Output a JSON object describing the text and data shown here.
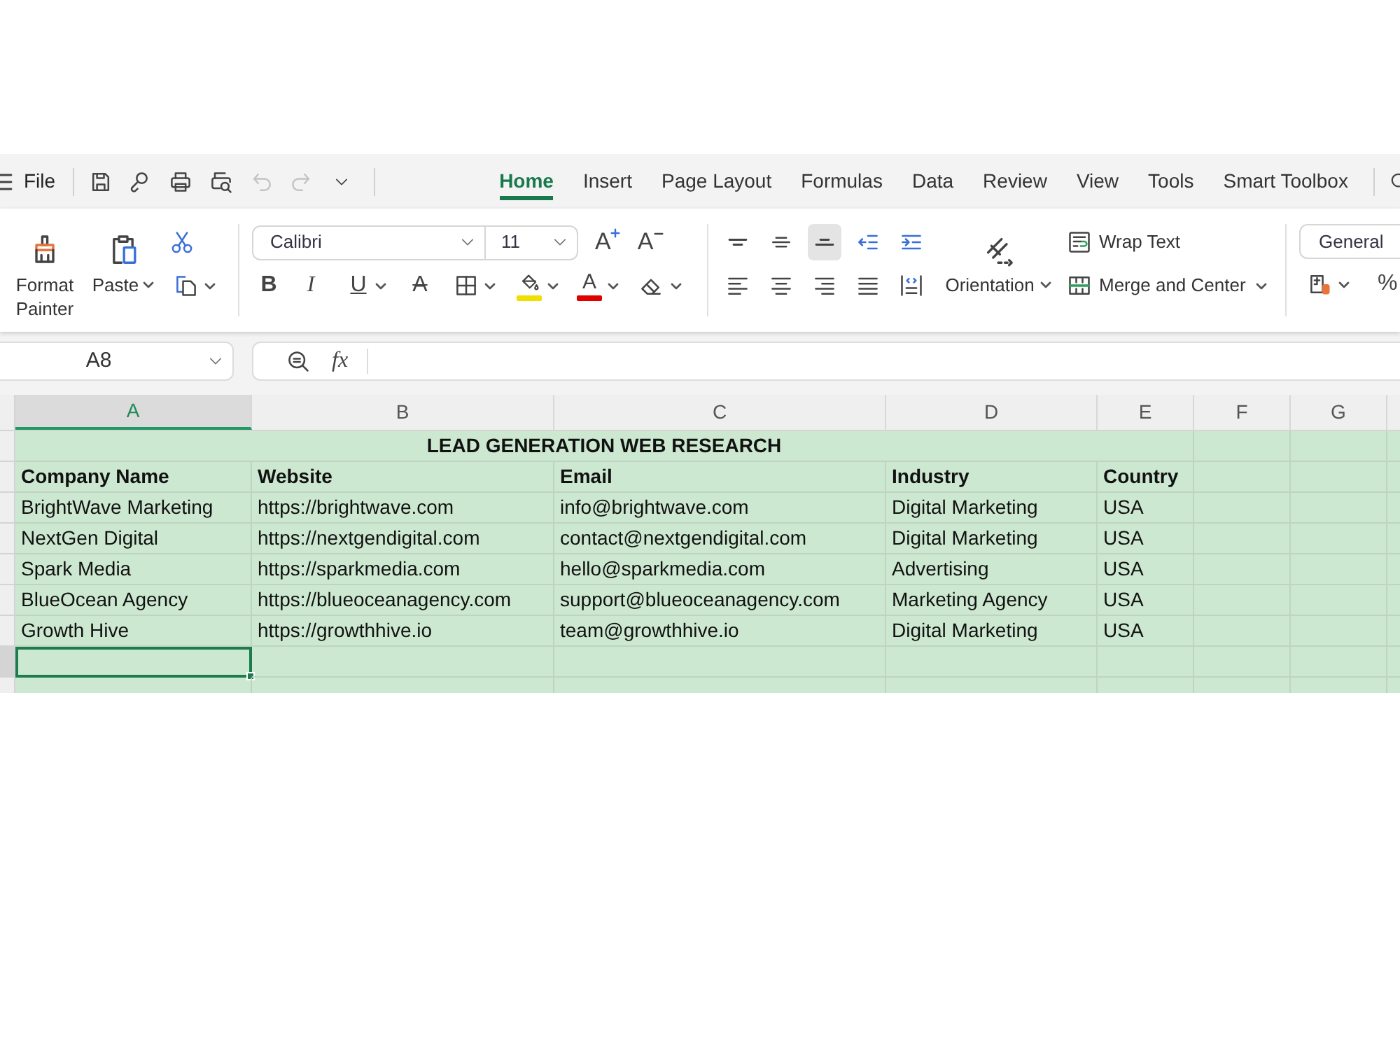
{
  "menu_bar": {
    "file": "File",
    "quick_access": [
      {
        "kind": "save",
        "disabled": false
      },
      {
        "kind": "share",
        "disabled": false
      },
      {
        "kind": "print",
        "disabled": false
      },
      {
        "kind": "preview",
        "disabled": false
      },
      {
        "kind": "undo",
        "disabled": true
      },
      {
        "kind": "redo",
        "disabled": true
      },
      {
        "kind": "more",
        "disabled": false
      }
    ],
    "tabs": [
      {
        "label": "Home",
        "selected": true
      },
      {
        "label": "Insert",
        "selected": false
      },
      {
        "label": "Page Layout",
        "selected": false
      },
      {
        "label": "Formulas",
        "selected": false
      },
      {
        "label": "Data",
        "selected": false
      },
      {
        "label": "Review",
        "selected": false
      },
      {
        "label": "View",
        "selected": false
      },
      {
        "label": "Tools",
        "selected": false
      },
      {
        "label": "Smart Toolbox",
        "selected": false
      }
    ]
  },
  "ribbon": {
    "clipboard": {
      "format_painter": "Format Painter",
      "paste": "Paste"
    },
    "font": {
      "name": "Calibri",
      "size": "11",
      "grow": "A",
      "shrink": "A",
      "styles": [
        {
          "kind": "bold",
          "glyph": "B"
        },
        {
          "kind": "italic",
          "glyph": "I"
        },
        {
          "kind": "underline",
          "glyph": "U"
        },
        {
          "kind": "strikethrough",
          "glyph": "A"
        }
      ],
      "color_buttons": [
        {
          "kind": "fill",
          "color": "#f0e000"
        },
        {
          "kind": "font",
          "glyph": "A",
          "color": "#e00000"
        }
      ]
    },
    "alignment": {
      "vertical": [
        {
          "kind": "top",
          "selected": false
        },
        {
          "kind": "middle",
          "selected": false
        },
        {
          "kind": "bottom",
          "selected": true
        }
      ],
      "orientation": "Orientation",
      "wrap_text": "Wrap Text",
      "merge": "Merge and Center"
    },
    "number": {
      "format": "General",
      "percent": "%"
    }
  },
  "formula_bar": {
    "name_box": "A8",
    "function_label": "fx"
  },
  "sheet": {
    "columns": [
      {
        "label": "A",
        "selected": true
      },
      {
        "label": "B",
        "selected": false
      },
      {
        "label": "C",
        "selected": false
      },
      {
        "label": "D",
        "selected": false
      },
      {
        "label": "E",
        "selected": false
      },
      {
        "label": "F",
        "selected": false
      },
      {
        "label": "G",
        "selected": false
      }
    ],
    "rows": [
      {
        "kind": "title",
        "text": "LEAD GENERATION WEB RESEARCH",
        "selected": false
      },
      {
        "kind": "header",
        "cells": [
          "Company Name",
          "Website",
          "Email",
          "Industry",
          "Country"
        ],
        "selected": false
      },
      {
        "kind": "data",
        "cells": [
          "BrightWave Marketing",
          "https://brightwave.com",
          "info@brightwave.com",
          "Digital Marketing",
          "USA"
        ],
        "selected": false
      },
      {
        "kind": "data",
        "cells": [
          "NextGen Digital",
          "https://nextgendigital.com",
          "contact@nextgendigital.com",
          "Digital Marketing",
          "USA"
        ],
        "selected": false
      },
      {
        "kind": "data",
        "cells": [
          "Spark Media",
          "https://sparkmedia.com",
          "hello@sparkmedia.com",
          "Advertising",
          "USA"
        ],
        "selected": false
      },
      {
        "kind": "data",
        "cells": [
          "BlueOcean Agency",
          "https://blueoceanagency.com",
          "support@blueoceanagency.com",
          "Marketing Agency",
          "USA"
        ],
        "selected": false
      },
      {
        "kind": "data",
        "cells": [
          "Growth Hive",
          "https://growthhive.io",
          "team@growthhive.io",
          "Digital Marketing",
          "USA"
        ],
        "selected": false
      },
      {
        "kind": "empty",
        "selected": true
      },
      {
        "kind": "empty",
        "selected": false
      }
    ]
  }
}
